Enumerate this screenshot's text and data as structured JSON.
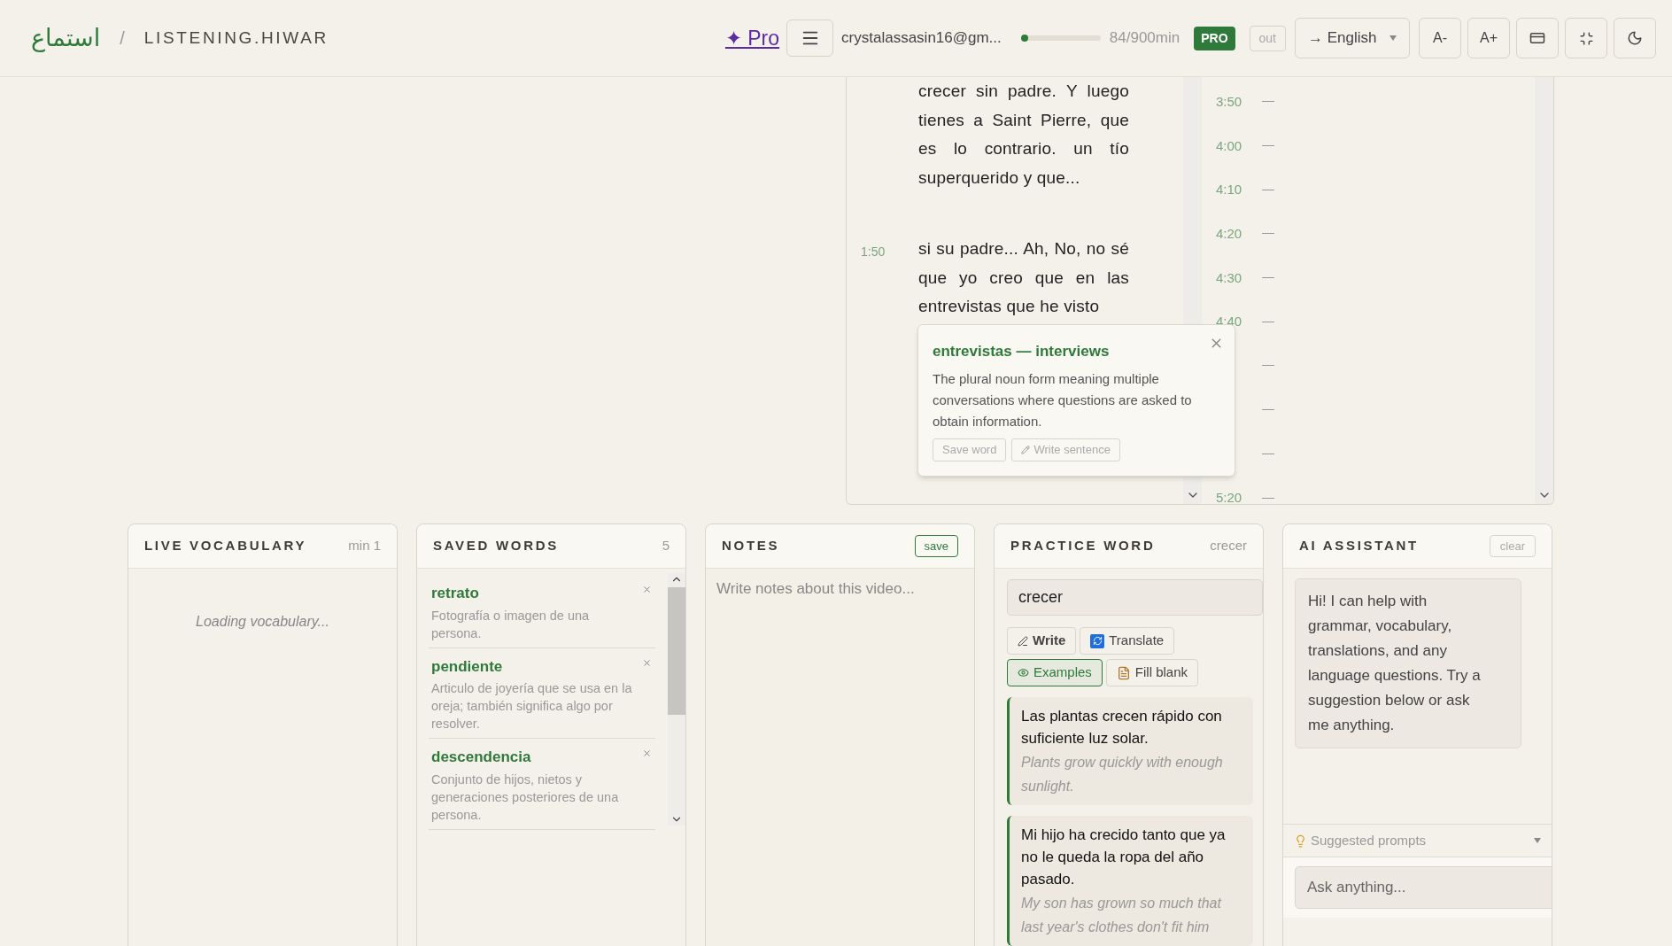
{
  "header": {
    "logo": "استماع",
    "separator": "/",
    "title": "LISTENING.HIWAR",
    "pro_link": "✦ Pro",
    "user_email": "crystalassasin16@gm...",
    "usage": {
      "level": 0.05,
      "reading": "84/900min"
    },
    "plan_badge": "PRO",
    "logout": "out",
    "language": "→ English",
    "font_smaller": "A-",
    "font_larger": "A+"
  },
  "transcript": {
    "segments": [
      {
        "text": "crecer sin padre. Y luego tienes a Saint Pierre, que es lo contrario. un tío superquerido y que..."
      },
      {
        "time": "1:50",
        "text": "si su padre... Ah, No, no sé que yo creo que en las entrevistas que he visto"
      }
    ],
    "popup": {
      "title": "entrevistas — interviews",
      "description": "The plural noun form meaning multiple conversations where questions are asked to obtain information.",
      "buttons": [
        "Save word",
        "Write sentence"
      ]
    }
  },
  "timeline": [
    {
      "kind": "time",
      "time": "3:50"
    },
    {
      "kind": "time",
      "time": "4:00"
    },
    {
      "kind": "time",
      "time": "4:10"
    },
    {
      "kind": "time",
      "time": "4:20"
    },
    {
      "kind": "time",
      "time": "4:30"
    },
    {
      "kind": "time",
      "time": "4:40"
    },
    {
      "kind": "tick"
    },
    {
      "kind": "tick"
    },
    {
      "kind": "tick"
    },
    {
      "kind": "time",
      "time": "5:20"
    }
  ],
  "live_vocabulary": {
    "title": "LIVE VOCABULARY",
    "meta": "min 1",
    "status": "Loading vocabulary..."
  },
  "saved_words": {
    "title": "SAVED WORDS",
    "count": "5",
    "items": [
      {
        "word": "retrato",
        "definition": "Fotografía o imagen de una persona."
      },
      {
        "word": "pendiente",
        "definition": "Articulo de joyería que se usa en la oreja; también significa algo por resolver."
      },
      {
        "word": "descendencia",
        "definition": "Conjunto de hijos, nietos y generaciones posteriores de una persona."
      }
    ]
  },
  "notes": {
    "title": "NOTES",
    "save": "save",
    "placeholder": "Write notes about this video..."
  },
  "practice_word": {
    "title": "PRACTICE WORD",
    "meta": "crecer",
    "value": "crecer",
    "modes": [
      {
        "kind": "write",
        "label": "Write",
        "bold": true,
        "selected": false
      },
      {
        "kind": "translate",
        "label": "Translate",
        "bold": false,
        "selected": false
      },
      {
        "kind": "examples",
        "label": "Examples",
        "bold": false,
        "selected": true
      },
      {
        "kind": "fill",
        "label": "Fill blank",
        "bold": false,
        "selected": false
      }
    ],
    "examples": [
      {
        "sentence": "Las plantas crecen rápido con suficiente luz solar.",
        "translation": "Plants grow quickly with enough sunlight."
      },
      {
        "sentence": "Mi hijo ha crecido tanto que ya no le queda la ropa del año pasado.",
        "translation": "My son has grown so much that last year's clothes don't fit him"
      }
    ]
  },
  "ai_assistant": {
    "title": "AI ASSISTANT",
    "clear": "clear",
    "message": "Hi! I can help with grammar, vocabulary, translations, and any language questions. Try a suggestion below or ask me anything.",
    "suggested": "Suggested prompts",
    "placeholder": "Ask anything..."
  }
}
